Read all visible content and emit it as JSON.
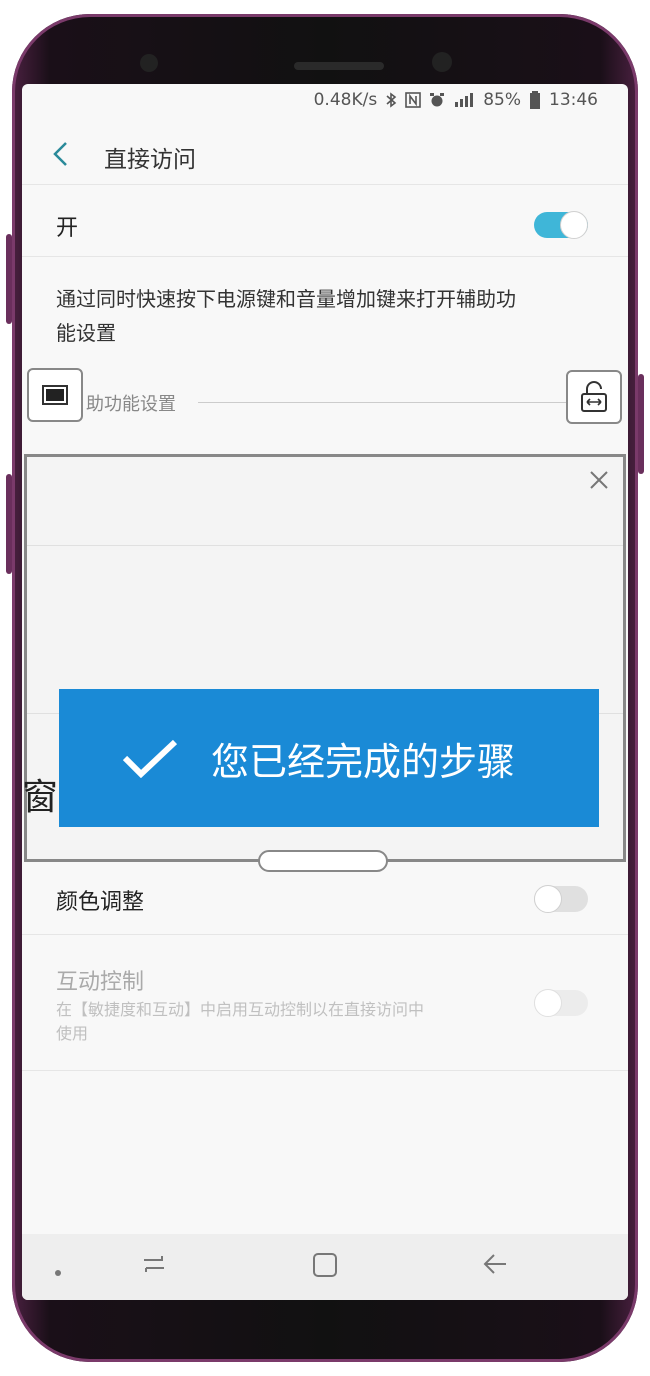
{
  "status_bar": {
    "network_speed": "0.48K/s",
    "battery": "85%",
    "time": "13:46",
    "icons": [
      "bluetooth-icon",
      "nfc-icon",
      "alarm-icon",
      "signal-icon",
      "battery-icon"
    ]
  },
  "header": {
    "title": "直接访问"
  },
  "main_switch": {
    "label": "开",
    "state": true,
    "accent": "#3fb6d8"
  },
  "description": "通过同时快速按下电源键和音量增加键来打开辅助功能设置",
  "section": {
    "label": "助功能设置"
  },
  "overlay": {
    "banner_text": "您已经完成的步骤",
    "banner_color": "#1a8ad6"
  },
  "edge_text": "窗",
  "settings": {
    "color_adjust": {
      "label": "颜色调整",
      "state": false
    },
    "interaction_control": {
      "label": "互动控制",
      "sub": "在【敏捷度和互动】中启用互动控制以在直接访问中使用",
      "state": false,
      "enabled": false
    }
  },
  "navbar": {
    "icons": [
      "dot-icon",
      "recent-apps-icon",
      "home-icon",
      "back-icon"
    ]
  }
}
